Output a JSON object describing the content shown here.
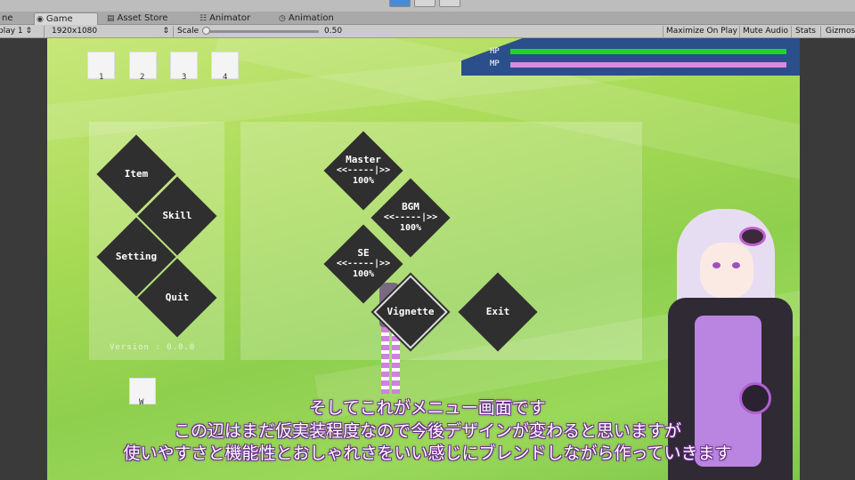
{
  "tabs": [
    {
      "label": "ne",
      "icon": ""
    },
    {
      "label": "Game",
      "icon": "game-icon"
    },
    {
      "label": "Asset Store",
      "icon": "store-icon"
    },
    {
      "label": "Animator",
      "icon": "animator-icon"
    },
    {
      "label": "Animation",
      "icon": "animation-icon"
    }
  ],
  "toolbar": {
    "display": "play 1",
    "resolution": "1920x1080",
    "scale_label": "Scale",
    "scale_value": "0.50",
    "maximize": "Maximize On Play",
    "mute": "Mute Audio",
    "stats": "Stats",
    "gizmos": "Gizmos"
  },
  "hud": {
    "hp_label": "HP",
    "mp_label": "MP",
    "hp_color": "#1ed81e",
    "mp_color": "#d98ae0",
    "hp_fraction": 1.0,
    "mp_fraction": 1.0
  },
  "slots": [
    "1",
    "2",
    "3",
    "4"
  ],
  "bottom_slot": "W",
  "menu": {
    "item": "Item",
    "skill": "Skill",
    "setting": "Setting",
    "quit": "Quit",
    "version": "Version : 0.0.0"
  },
  "settings": {
    "master": "Master",
    "master_value": "100%",
    "bgm": "BGM",
    "bgm_value": "100%",
    "se": "SE",
    "se_value": "100%",
    "slider_glyph": "<<-----|>>",
    "vignette": "Vignette",
    "exit": "Exit"
  },
  "subtitles": [
    "そしてこれがメニュー画面です",
    "この辺はまだ仮実装程度なので今後デザインが変わると思いますが",
    "使いやすさと機能性とおしゃれさをいい感じにブレンドしながら作っていきます"
  ]
}
